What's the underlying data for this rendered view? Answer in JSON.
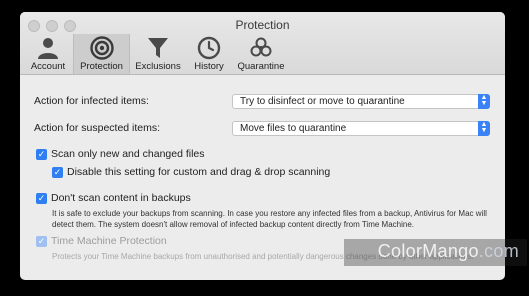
{
  "window": {
    "title": "Protection"
  },
  "toolbar": {
    "tabs": [
      {
        "label": "Account",
        "icon": "person-icon"
      },
      {
        "label": "Protection",
        "icon": "shield-ring-icon",
        "active": true
      },
      {
        "label": "Exclusions",
        "icon": "funnel-icon"
      },
      {
        "label": "History",
        "icon": "clock-icon"
      },
      {
        "label": "Quarantine",
        "icon": "biohazard-icon"
      }
    ]
  },
  "settings": {
    "infected_label": "Action for infected items:",
    "infected_value": "Try to disinfect or move to quarantine",
    "suspected_label": "Action for suspected items:",
    "suspected_value": "Move files to quarantine",
    "scan_new_label": "Scan only new and changed files",
    "scan_new_checked": true,
    "disable_custom_label": "Disable this setting for custom and drag & drop scanning",
    "disable_custom_checked": true,
    "dont_scan_backups_label": "Don't scan content in backups",
    "dont_scan_backups_checked": true,
    "backups_note": "It is safe to exclude your backups from scanning. In case you restore any infected files from a backup, Antivirus for Mac will detect them. The system doesn't allow removal of infected backup content directly from Time Machine.",
    "time_machine_label": "Time Machine Protection",
    "time_machine_checked": true,
    "time_machine_note": "Protects your Time Machine backups from unauthorised and potentially dangerous changes done by other applications."
  },
  "watermark": {
    "text_a": "ColorMango",
    "text_b": ".com"
  },
  "colors": {
    "accent": "#2f7ff2",
    "window_bg": "#ececec"
  }
}
